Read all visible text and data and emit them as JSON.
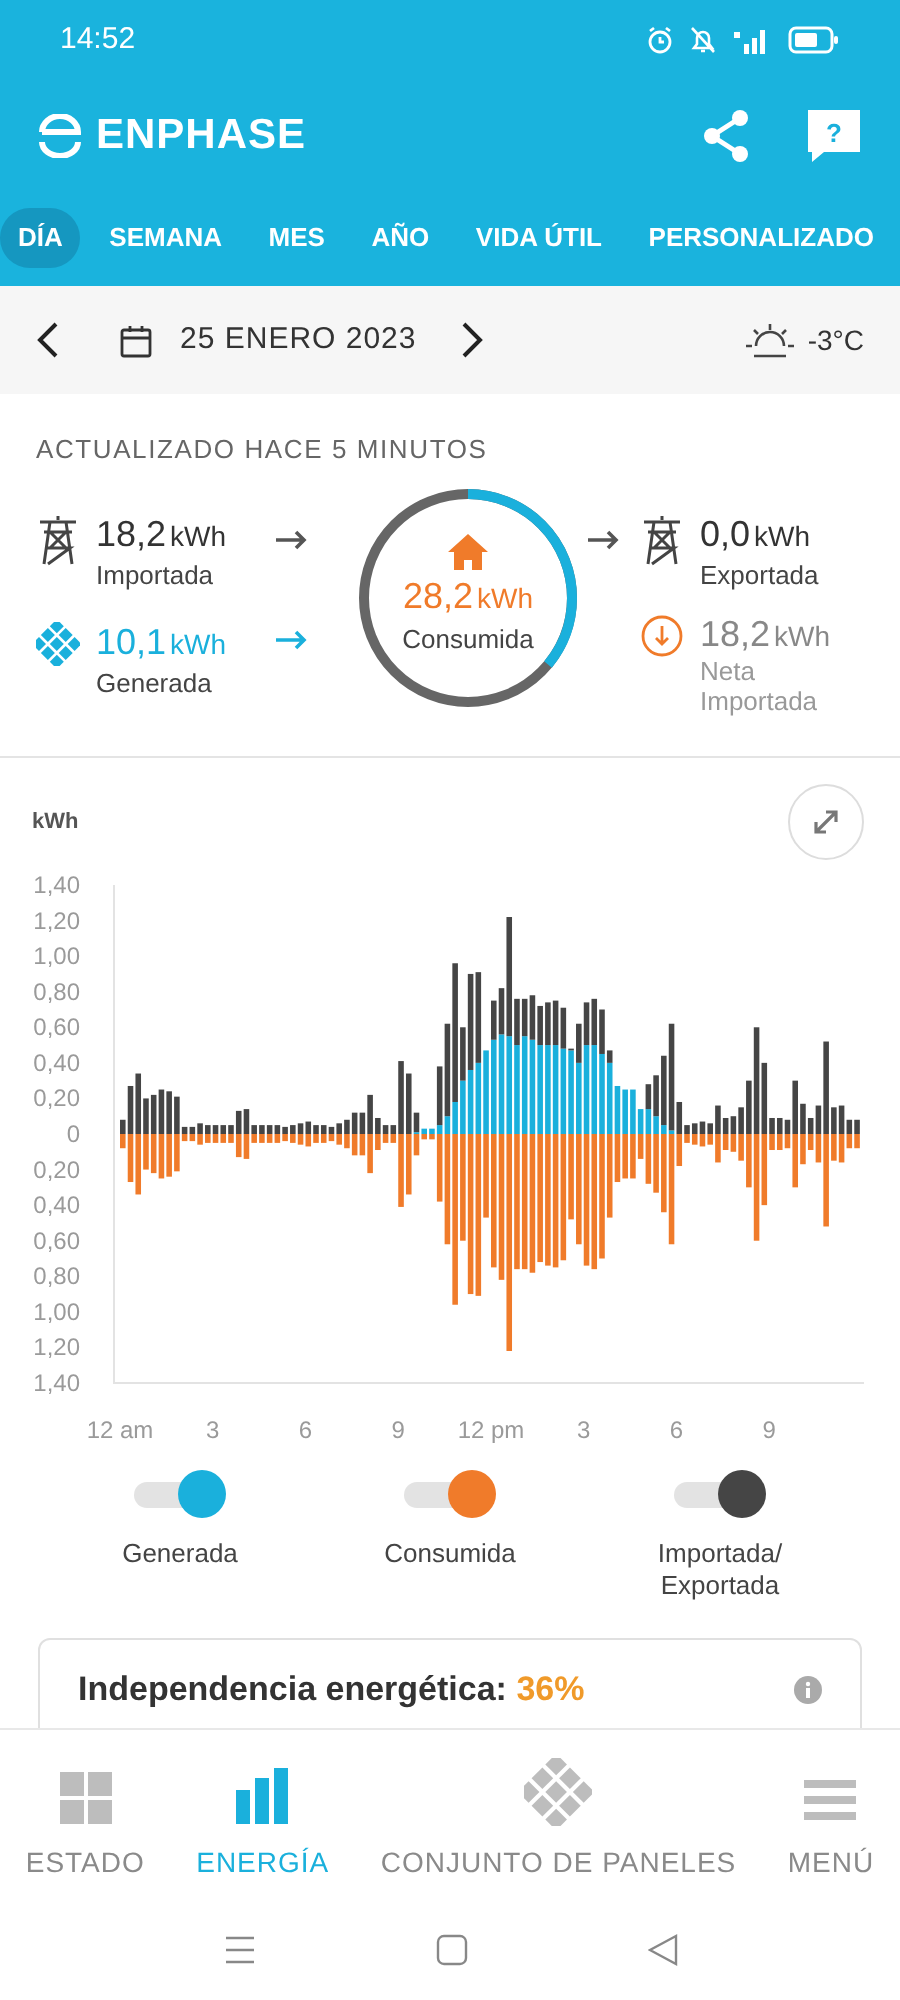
{
  "status_bar": {
    "time": "14:52"
  },
  "header": {
    "logo": "ENPHASE",
    "help_label": "?"
  },
  "tabs": [
    {
      "label": "DÍA",
      "selected": true
    },
    {
      "label": "SEMANA",
      "selected": false
    },
    {
      "label": "MES",
      "selected": false
    },
    {
      "label": "AÑO",
      "selected": false
    },
    {
      "label": "VIDA ÚTIL",
      "selected": false
    },
    {
      "label": "PERSONALIZADO",
      "selected": false
    }
  ],
  "date_bar": {
    "date": "25 ENERO 2023",
    "temperature": "-3°C"
  },
  "summary": {
    "updated": "ACTUALIZADO HACE 5 MINUTOS",
    "imported": {
      "value": "18,2",
      "unit": "kWh",
      "label": "Importada"
    },
    "generated": {
      "value": "10,1",
      "unit": "kWh",
      "label": "Generada"
    },
    "consumed": {
      "value": "28,2",
      "unit": "kWh",
      "label": "Consumida"
    },
    "exported": {
      "value": "0,0",
      "unit": "kWh",
      "label": "Exportada"
    },
    "net": {
      "value": "18,2",
      "unit": "kWh",
      "label": "Neta Importada"
    }
  },
  "chart": {
    "unit_label": "kWh",
    "chart_data": {
      "type": "bar",
      "stacked": true,
      "categories": [
        "12 am",
        null,
        null,
        null,
        null,
        null,
        null,
        null,
        null,
        null,
        null,
        null,
        "3",
        null,
        null,
        null,
        null,
        null,
        null,
        null,
        null,
        null,
        null,
        null,
        "6",
        null,
        null,
        null,
        null,
        null,
        null,
        null,
        null,
        null,
        null,
        null,
        "9",
        null,
        null,
        null,
        null,
        null,
        null,
        null,
        null,
        null,
        null,
        null,
        "12 pm",
        null,
        null,
        null,
        null,
        null,
        null,
        null,
        null,
        null,
        null,
        null,
        "3",
        null,
        null,
        null,
        null,
        null,
        null,
        null,
        null,
        null,
        null,
        null,
        "6",
        null,
        null,
        null,
        null,
        null,
        null,
        null,
        null,
        null,
        null,
        null,
        "9",
        null,
        null,
        null,
        null,
        null,
        null,
        null,
        null,
        null,
        null,
        null
      ],
      "ylim": [
        -1.4,
        1.4
      ],
      "yticks": [
        {
          "value": 1.4,
          "label": "1,40"
        },
        {
          "value": 1.2,
          "label": "1,20"
        },
        {
          "value": 1.0,
          "label": "1,00"
        },
        {
          "value": 0.8,
          "label": "0,80"
        },
        {
          "value": 0.6,
          "label": "0,60"
        },
        {
          "value": 0.4,
          "label": "0,40"
        },
        {
          "value": 0.2,
          "label": "0,20"
        },
        {
          "value": 0,
          "label": "0"
        },
        {
          "value": -0.2,
          "label": "0,20"
        },
        {
          "value": -0.4,
          "label": "0,40"
        },
        {
          "value": -0.6,
          "label": "0,60"
        },
        {
          "value": -0.8,
          "label": "0,80"
        },
        {
          "value": -1.0,
          "label": "1,00"
        },
        {
          "value": -1.2,
          "label": "1,20"
        },
        {
          "value": -1.4,
          "label": "1,40"
        }
      ],
      "series": [
        {
          "name": "Generada",
          "color": "#1ab0dc",
          "values": [
            0,
            0,
            0,
            0,
            0,
            0,
            0,
            0,
            0,
            0,
            0,
            0,
            0,
            0,
            0,
            0,
            0,
            0,
            0,
            0,
            0,
            0,
            0,
            0,
            0,
            0,
            0,
            0,
            0,
            0,
            0,
            0,
            0,
            0,
            0,
            0,
            0,
            0,
            0.01,
            0.03,
            0.03,
            0.05,
            0.1,
            0.18,
            0.3,
            0.36,
            0.4,
            0.47,
            0.53,
            0.56,
            0.55,
            0.5,
            0.55,
            0.53,
            0.5,
            0.5,
            0.5,
            0.48,
            0.47,
            0.4,
            0.5,
            0.5,
            0.45,
            0.4,
            0.27,
            0.25,
            0.25,
            0.14,
            0.14,
            0.1,
            0.05,
            0.02,
            0,
            0,
            0,
            0,
            0,
            0,
            0,
            0,
            0,
            0,
            0,
            0,
            0,
            0,
            0,
            0,
            0,
            0,
            0,
            0,
            0,
            0,
            0,
            0
          ]
        },
        {
          "name": "Consumida",
          "color": "#f07b2a",
          "values": [
            -0.08,
            -0.27,
            -0.34,
            -0.2,
            -0.22,
            -0.25,
            -0.24,
            -0.21,
            -0.04,
            -0.04,
            -0.06,
            -0.05,
            -0.05,
            -0.05,
            -0.05,
            -0.13,
            -0.14,
            -0.05,
            -0.05,
            -0.05,
            -0.05,
            -0.04,
            -0.05,
            -0.06,
            -0.07,
            -0.05,
            -0.05,
            -0.04,
            -0.06,
            -0.08,
            -0.12,
            -0.12,
            -0.22,
            -0.09,
            -0.05,
            -0.05,
            -0.41,
            -0.34,
            -0.12,
            -0.03,
            -0.03,
            -0.38,
            -0.62,
            -0.96,
            -0.6,
            -0.9,
            -0.91,
            -0.47,
            -0.75,
            -0.82,
            -1.22,
            -0.76,
            -0.76,
            -0.78,
            -0.72,
            -0.74,
            -0.75,
            -0.71,
            -0.48,
            -0.62,
            -0.74,
            -0.76,
            -0.7,
            -0.47,
            -0.27,
            -0.25,
            -0.25,
            -0.14,
            -0.28,
            -0.33,
            -0.44,
            -0.62,
            -0.18,
            -0.05,
            -0.06,
            -0.07,
            -0.06,
            -0.16,
            -0.09,
            -0.1,
            -0.15,
            -0.3,
            -0.6,
            -0.4,
            -0.09,
            -0.09,
            -0.08,
            -0.3,
            -0.17,
            -0.09,
            -0.16,
            -0.52,
            -0.15,
            -0.16,
            -0.08,
            -0.08
          ]
        },
        {
          "name": "Importada/ Exportada",
          "color": "#454545",
          "values": [
            0.08,
            0.27,
            0.34,
            0.2,
            0.22,
            0.25,
            0.24,
            0.21,
            0.04,
            0.04,
            0.06,
            0.05,
            0.05,
            0.05,
            0.05,
            0.13,
            0.14,
            0.05,
            0.05,
            0.05,
            0.05,
            0.04,
            0.05,
            0.06,
            0.07,
            0.05,
            0.05,
            0.04,
            0.06,
            0.08,
            0.12,
            0.12,
            0.22,
            0.09,
            0.05,
            0.05,
            0.41,
            0.34,
            0.11,
            0,
            0,
            0.33,
            0.52,
            0.78,
            0.3,
            0.54,
            0.51,
            0,
            0.22,
            0.26,
            0.67,
            0.26,
            0.21,
            0.25,
            0.22,
            0.24,
            0.25,
            0.23,
            0.01,
            0.22,
            0.24,
            0.26,
            0.25,
            0.07,
            0,
            0,
            0,
            0,
            0.14,
            0.23,
            0.39,
            0.6,
            0.18,
            0.05,
            0.06,
            0.07,
            0.06,
            0.16,
            0.09,
            0.1,
            0.15,
            0.3,
            0.6,
            0.4,
            0.09,
            0.09,
            0.08,
            0.3,
            0.17,
            0.09,
            0.16,
            0.52,
            0.15,
            0.16,
            0.08,
            0.08
          ]
        }
      ]
    }
  },
  "legend": [
    {
      "on": true
    },
    {
      "on": true
    },
    {
      "on": true
    }
  ],
  "card": {
    "title": "Independencia energética:",
    "value": "36%"
  },
  "bottom_nav": [
    {
      "label": "ESTADO",
      "selected": false,
      "kind": "grid"
    },
    {
      "label": "ENERGÍA",
      "selected": true,
      "kind": "bars"
    },
    {
      "label": "CONJUNTO DE PANELES",
      "selected": false,
      "kind": "panels"
    },
    {
      "label": "MENÚ",
      "selected": false,
      "kind": "menu"
    }
  ]
}
